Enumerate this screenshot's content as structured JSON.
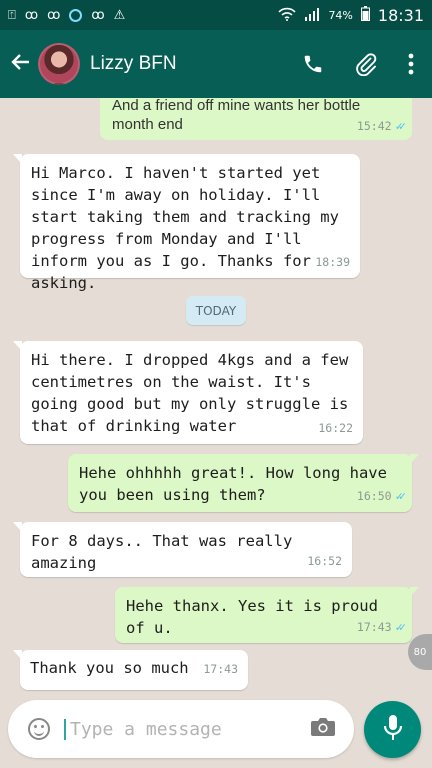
{
  "status_bar": {
    "battery": "74%",
    "time": "18:31"
  },
  "header": {
    "contact_name": "Lizzy BFN"
  },
  "chat": {
    "partial_message": {
      "text": "And a friend off mine wants her bottle month end",
      "time": "15:42"
    },
    "date_divider": "TODAY",
    "messages": [
      {
        "direction": "in",
        "text": "Hi Marco. I haven't started yet since I'm away on holiday. I'll start taking them and tracking my progress from Monday and I'll inform you as I go. Thanks for asking.",
        "time": "18:39"
      },
      {
        "direction": "in",
        "text": "Hi there. I dropped 4kgs and a few centimetres on the waist. It's going good but my only struggle is that of drinking water",
        "time": "16:22"
      },
      {
        "direction": "out",
        "text": "Hehe ohhhhh great!. How long have you been using them?",
        "time": "16:50"
      },
      {
        "direction": "in",
        "text": "For 8 days.. That was really amazing",
        "time": "16:52"
      },
      {
        "direction": "out",
        "text": "Hehe thanx. Yes it is proud of u.",
        "time": "17:43"
      },
      {
        "direction": "in",
        "text": "Thank you so much",
        "time": "17:43"
      }
    ],
    "scroll_badge": "80"
  },
  "composer": {
    "placeholder": "Type a message"
  },
  "colors": {
    "header": "#075e54",
    "status_bar": "#054d44",
    "outgoing_bubble": "#dcf8c6",
    "incoming_bubble": "#ffffff",
    "chat_bg": "#e5ddd5",
    "mic_button": "#00897b",
    "read_ticks": "#4fc3f7"
  },
  "icons": [
    "back-arrow-icon",
    "phone-icon",
    "attach-icon",
    "more-icon",
    "emoji-icon",
    "camera-icon",
    "mic-icon",
    "read-receipt-icon"
  ]
}
